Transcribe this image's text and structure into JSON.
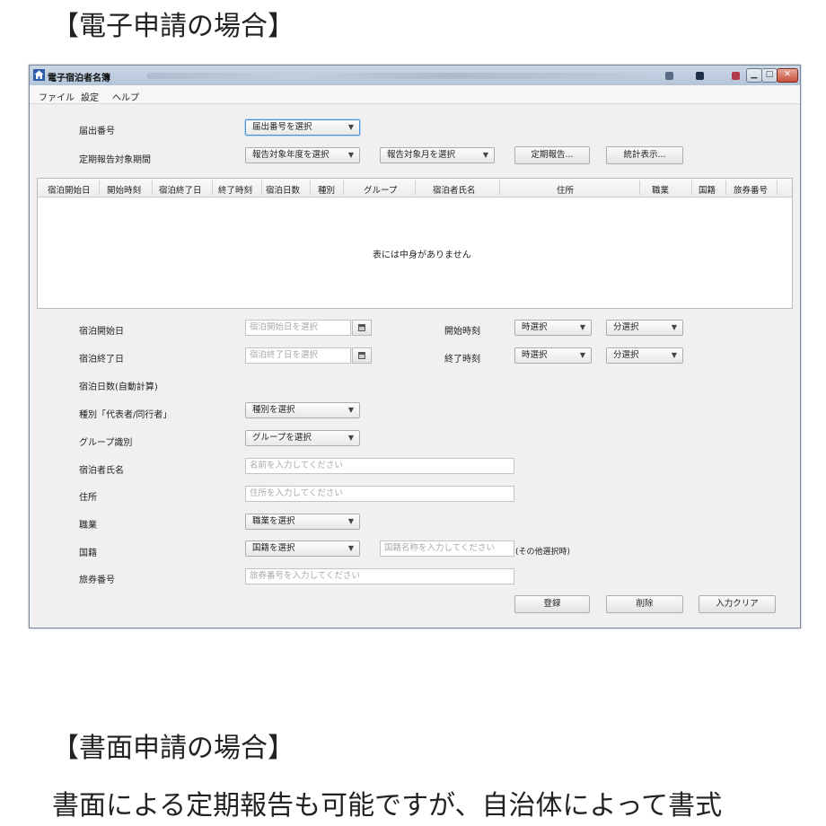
{
  "page": {
    "heading_electronic": "【電子申請の場合】",
    "heading_paper": "【書面申請の場合】",
    "body_text": "書面による定期報告も可能ですが、自治体によって書式"
  },
  "window": {
    "title": "電子宿泊者名簿",
    "controls": {
      "minimize": "▁",
      "maximize": "□",
      "close": "✕"
    }
  },
  "menu": [
    "ファイル",
    "設定",
    "ヘルプ"
  ],
  "top_form": {
    "notification_number_label": "届出番号",
    "notification_number_select": "届出番号を選択",
    "period_label": "定期報告対象期間",
    "fiscal_year_select": "報告対象年度を選択",
    "month_select": "報告対象月を選択",
    "periodic_report_button": "定期報告...",
    "statistics_button": "統計表示..."
  },
  "table": {
    "columns": [
      "宿泊開始日",
      "開始時刻",
      "宿泊終了日",
      "終了時刻",
      "宿泊日数",
      "種別",
      "グループ",
      "宿泊者氏名",
      "住所",
      "職業",
      "国籍",
      "旅券番号"
    ],
    "empty_message": "表には中身がありません"
  },
  "detail_form": {
    "start_date_label": "宿泊開始日",
    "start_date_placeholder": "宿泊開始日を選択",
    "start_time_label": "開始時刻",
    "end_date_label": "宿泊終了日",
    "end_date_placeholder": "宿泊終了日を選択",
    "end_time_label": "終了時刻",
    "hour_select": "時選択",
    "minute_select": "分選択",
    "nights_label": "宿泊日数(自動計算)",
    "type_label": "種別「代表者/同行者」",
    "type_select": "種別を選択",
    "group_label": "グループ識別",
    "group_select": "グループを選択",
    "name_label": "宿泊者氏名",
    "name_placeholder": "名前を入力してください",
    "address_label": "住所",
    "address_placeholder": "住所を入力してください",
    "occupation_label": "職業",
    "occupation_select": "職業を選択",
    "nationality_label": "国籍",
    "nationality_select": "国籍を選択",
    "nationality_name_placeholder": "国籍名称を入力してください",
    "nationality_note": "(その他選択時)",
    "passport_label": "旅券番号",
    "passport_placeholder": "旅券番号を入力してください"
  },
  "actions": {
    "register": "登録",
    "delete": "削除",
    "clear": "入力クリア"
  },
  "colors": {
    "focus_border": "#4a90d9",
    "titlebar": "#c9d6e6",
    "close_button": "#c8503a"
  }
}
